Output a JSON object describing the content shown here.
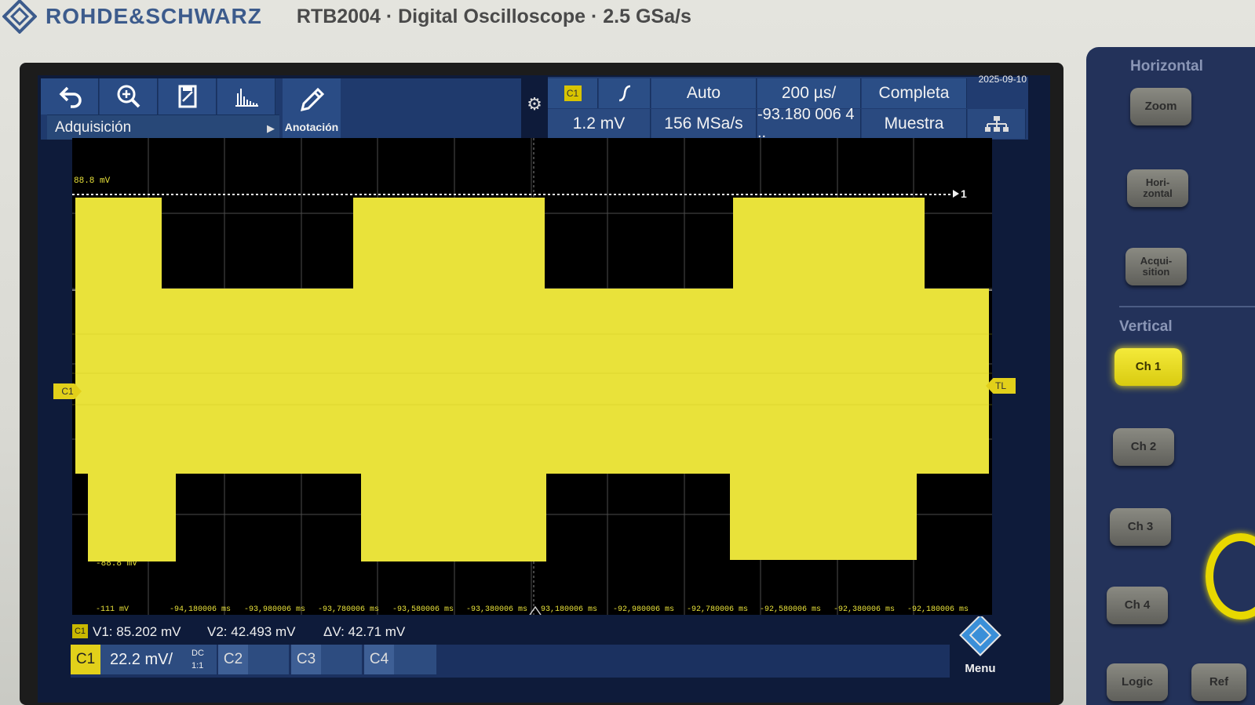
{
  "header": {
    "brand": "ROHDE&SCHWARZ",
    "model": "RTB2004 · Digital Oscilloscope · 2.5 GSa/s"
  },
  "toolbar": {
    "acquisition_label": "Adquisición",
    "annotation_label": "Anotación"
  },
  "trigger": {
    "source": "C1",
    "slope_icon": "rising-edge-icon",
    "mode": "Auto",
    "timebase": "200 µs/",
    "record": "Completa",
    "level": "1.2 mV",
    "sample_rate": "156 MSa/s",
    "position": "-93.180 006 4 ..",
    "acq_mode": "Muestra",
    "date": "2025-09-10"
  },
  "grid": {
    "top_label": "88.8 mV",
    "bottom_label": "-88.8 mV",
    "bottom_left_label": "-111 mV",
    "ref_marker": "1",
    "ch_marker": "C1",
    "trigger_level_marker": "TL",
    "time_ticks": [
      "-94,180006 ms",
      "-93,980006 ms",
      "-93,780006 ms",
      "-93,580006 ms",
      "-93,380006 ms",
      "93,180006 ms",
      "-92,980006 ms",
      "-92,780006 ms",
      "-92,580006 ms",
      "-92,380006 ms",
      "-92,180006 ms"
    ]
  },
  "cursors": {
    "v1": "V1: 85.202 mV",
    "v2": "V2: 42.493 mV",
    "dv": "ΔV: 42.71 mV"
  },
  "channels": {
    "c1": {
      "name": "C1",
      "scale": "22.2 mV/",
      "coupling": "DC",
      "probe": "1:1",
      "color": "#e8d400"
    },
    "c2": {
      "name": "C2"
    },
    "c3": {
      "name": "C3"
    },
    "c4": {
      "name": "C4"
    },
    "menu_label": "Menu"
  },
  "front_panel": {
    "horizontal_title": "Horizontal",
    "zoom_key": "Zoom",
    "horizontal_key": "Hori-\nzontal",
    "acquisition_key": "Acqui-\nsition",
    "vertical_title": "Vertical",
    "ch1_key": "Ch 1",
    "ch2_key": "Ch 2",
    "ch3_key": "Ch 3",
    "ch4_key": "Ch 4",
    "logic_key": "Logic",
    "ref_key": "Ref"
  },
  "colors": {
    "trace": "#e9e23a",
    "brand_blue": "#3c5b8c",
    "panel_blue": "#23325a"
  }
}
